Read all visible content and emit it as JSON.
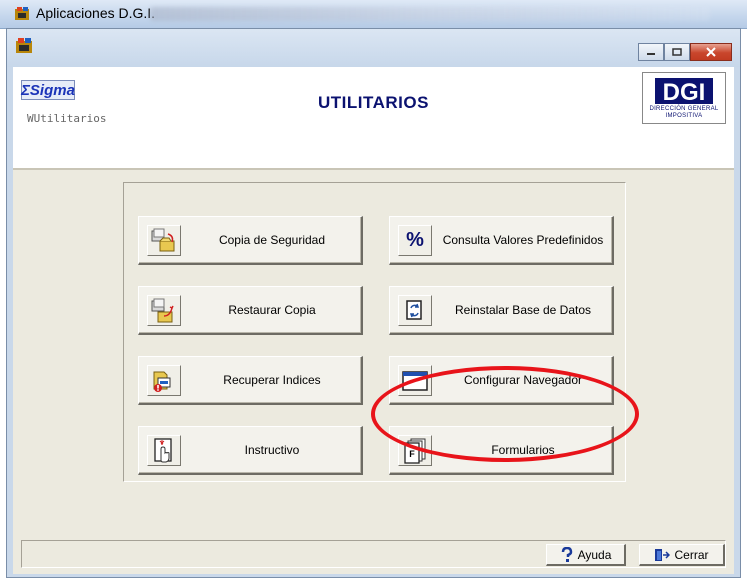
{
  "outer_window": {
    "title": "Aplicaciones  D.G.I."
  },
  "header": {
    "sigma_logo": "ΣSigma",
    "window_code": "WUtilitarios",
    "title": "UTILITARIOS",
    "dgi_logo_text": "DGI",
    "dgi_subtext_1": "DIRECCIÓN GENERAL",
    "dgi_subtext_2": "IMPOSITIVA"
  },
  "buttons": {
    "copia_seguridad": "Copia de Seguridad",
    "consulta_valores": "Consulta Valores Predefinidos",
    "restaurar_copia": "Restaurar Copia",
    "reinstalar_base": "Reinstalar Base de Datos",
    "recuperar_indices": "Recuperar Indices",
    "configurar_navegador": "Configurar Navegador",
    "instructivo": "Instructivo",
    "formularios": "Formularios"
  },
  "footer": {
    "ayuda": "Ayuda",
    "cerrar": "Cerrar"
  },
  "icons": {
    "percent_glyph": "%",
    "forms_glyph": "F"
  },
  "colors": {
    "title_blue": "#0b1270",
    "annotation_red": "#e8141a"
  }
}
